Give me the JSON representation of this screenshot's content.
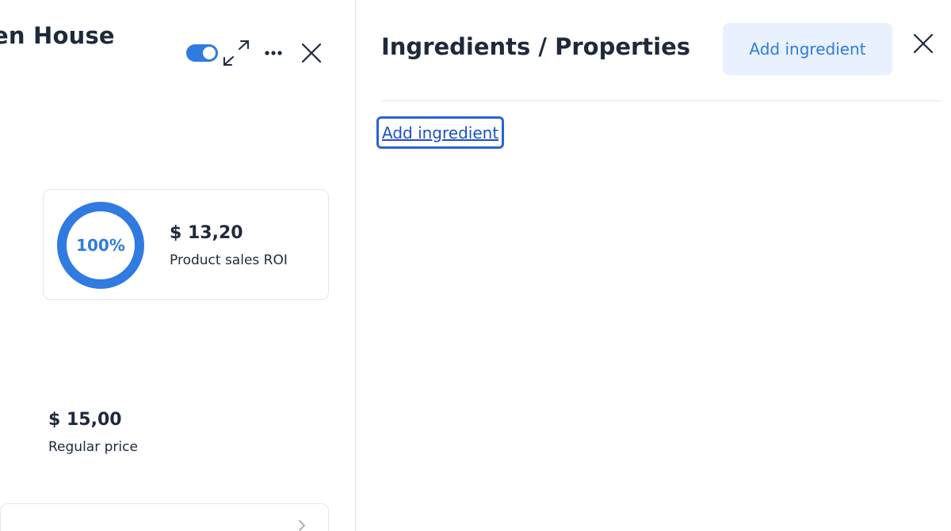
{
  "product": {
    "title_fragment": "en House",
    "toggle_on": true,
    "roi": {
      "percent_label": "100%",
      "percent_value": 1.0,
      "amount": "$ 13,20",
      "label": "Product sales ROI"
    },
    "price": {
      "amount": "$ 15,00",
      "label": "Regular price"
    }
  },
  "ingredients": {
    "title": "Ingredients / Properties",
    "add_button_label": "Add ingredient",
    "add_link_label": "Add ingredient"
  },
  "icons": {
    "expand": "expand-icon",
    "more": "more-horizontal-icon",
    "close": "close-icon",
    "chevron": "chevron-right-icon"
  },
  "colors": {
    "accent": "#2f7be0",
    "accent_light": "#e8f1fd",
    "text": "#1e2a3b",
    "border": "#e3e6ea",
    "focus": "#2864d8"
  }
}
